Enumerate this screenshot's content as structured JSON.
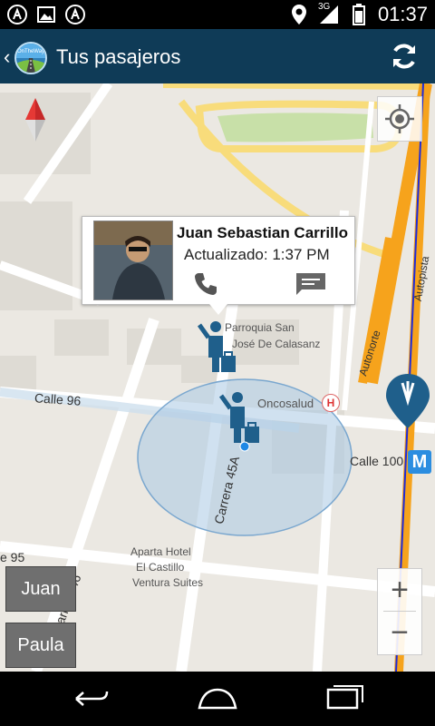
{
  "status_bar": {
    "time": "01:37",
    "network_label": "3G",
    "icons": [
      "notification-icon-1",
      "image-icon",
      "notification-icon-2",
      "location-icon",
      "signal-icon",
      "battery-icon"
    ]
  },
  "action_bar": {
    "title": "Tus pasajeros",
    "logo_label": "OnTheWay"
  },
  "bubble": {
    "name": "Juan Sebastian Carrillo",
    "updated": "Actualizado: 1:37 PM"
  },
  "map_labels": {
    "poi_parroquia_line1": "Parroquia San",
    "poi_parroquia_line2": "José De Calasanz",
    "poi_oncosalud": "Oncosalud",
    "calle96": "Calle 96",
    "calle100": "Calle 100",
    "carrera45a": "Carrera 45A",
    "carrera46": "Carrera 46",
    "calle95_partial": "e 95",
    "autonorte": "Autonorte",
    "autopista": "Autopista",
    "aparta_hotel_line1": "Aparta Hotel",
    "aparta_hotel_line2": "El Castillo",
    "aparta_hotel_line3": "Ventura Suites",
    "hospital_glyph": "H",
    "metro_glyph": "M"
  },
  "zoom": {
    "in": "+",
    "out": "−"
  },
  "passengers": [
    {
      "label": "Juan"
    },
    {
      "label": "Paula"
    }
  ],
  "colors": {
    "action_bar": "#0f3b57",
    "marker_blue": "#1f5f8b",
    "highway_orange": "#f6a31c",
    "accuracy_circle": "#a9c8e4"
  }
}
